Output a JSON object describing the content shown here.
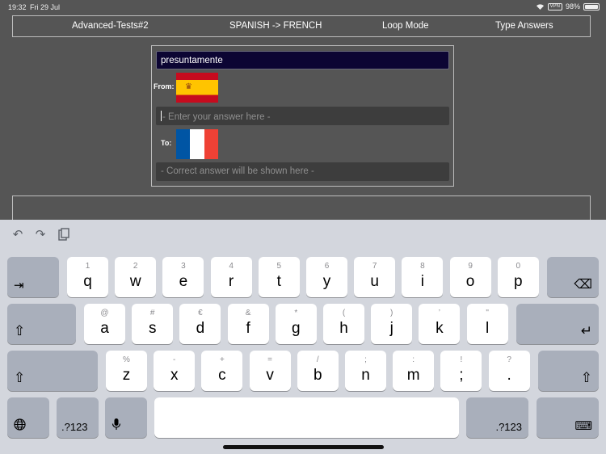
{
  "status_bar": {
    "time": "19:32",
    "date": "Fri 29 Jul",
    "vpn": "VPN",
    "battery": "98%",
    "battery_level": 0.98
  },
  "menu": {
    "items": [
      "Advanced-Tests#2",
      "SPANISH -> FRENCH",
      "Loop Mode",
      "Type Answers"
    ]
  },
  "quiz": {
    "word": "presuntamente",
    "from_label": "From:",
    "to_label": "To:",
    "from_flag": "spain-flag",
    "to_flag": "france-flag",
    "answer_placeholder": "- Enter your answer here -",
    "correct_placeholder": "- Correct answer will be shown here -"
  },
  "keyboard": {
    "toolbar_icons": [
      "undo-icon",
      "redo-icon",
      "paste-icon"
    ],
    "row1": [
      {
        "pri": "q",
        "sec": "1"
      },
      {
        "pri": "w",
        "sec": "2"
      },
      {
        "pri": "e",
        "sec": "3"
      },
      {
        "pri": "r",
        "sec": "4"
      },
      {
        "pri": "t",
        "sec": "5"
      },
      {
        "pri": "y",
        "sec": "6"
      },
      {
        "pri": "u",
        "sec": "7"
      },
      {
        "pri": "i",
        "sec": "8"
      },
      {
        "pri": "o",
        "sec": "9"
      },
      {
        "pri": "p",
        "sec": "0"
      }
    ],
    "row2": [
      {
        "pri": "a",
        "sec": "@"
      },
      {
        "pri": "s",
        "sec": "#"
      },
      {
        "pri": "d",
        "sec": "€"
      },
      {
        "pri": "f",
        "sec": "&"
      },
      {
        "pri": "g",
        "sec": "*"
      },
      {
        "pri": "h",
        "sec": "("
      },
      {
        "pri": "j",
        "sec": ")"
      },
      {
        "pri": "k",
        "sec": "’"
      },
      {
        "pri": "l",
        "sec": "\""
      }
    ],
    "row3": [
      {
        "pri": "z",
        "sec": "%"
      },
      {
        "pri": "x",
        "sec": "-"
      },
      {
        "pri": "c",
        "sec": "+"
      },
      {
        "pri": "v",
        "sec": "="
      },
      {
        "pri": "b",
        "sec": "/"
      },
      {
        "pri": "n",
        "sec": ";"
      },
      {
        "pri": "m",
        "sec": ":"
      },
      {
        "pri": ";",
        "sec": "!"
      },
      {
        "pri": ".",
        "sec": "?"
      }
    ],
    "numbers_label": ".?123",
    "numbers_label_right": ".?123",
    "icons": {
      "tab": "⇥",
      "delete": "⌫",
      "shift": "⇧",
      "return": "↵",
      "globe": "🌐",
      "mic": "🎙",
      "hide": "⌨"
    }
  },
  "colors": {
    "background": "#555555",
    "word_box": "#0c0533",
    "keyboard": "#d3d6dd"
  }
}
